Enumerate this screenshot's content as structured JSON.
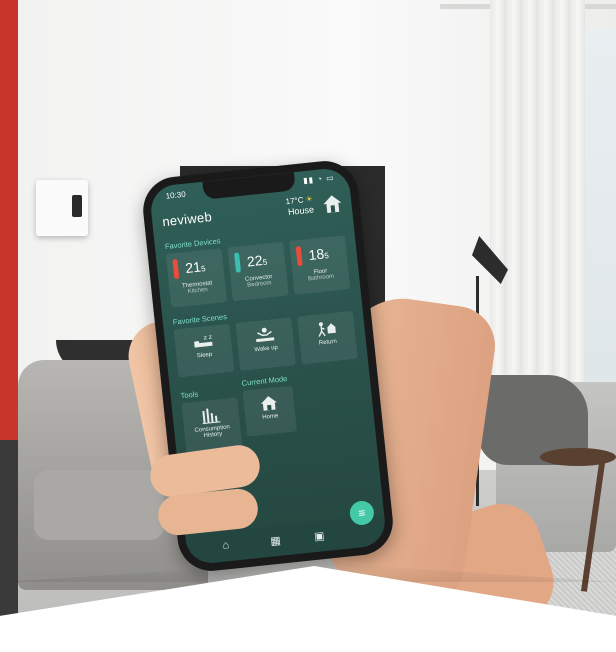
{
  "status_bar": {
    "time": "10:30",
    "indicators": "▮▮ ◔ ▭"
  },
  "header": {
    "logo": "neviweb",
    "outdoor_temp": "17°C",
    "weather_icon": "sun-icon",
    "location": "House"
  },
  "favorite_devices": {
    "title": "Favorite Devices",
    "items": [
      {
        "temp": "21",
        "decimal": "5",
        "name": "Thermostat",
        "room": "Kitchen",
        "color": "#e74c3c"
      },
      {
        "temp": "22",
        "decimal": "5",
        "name": "Convector",
        "room": "Bedroom",
        "color": "#39c0b0"
      },
      {
        "temp": "18",
        "decimal": "5",
        "name": "Floor",
        "room": "Bathroom",
        "color": "#e74c3c"
      }
    ]
  },
  "favorite_scenes": {
    "title": "Favorite Scenes",
    "items": [
      {
        "label": "Sleep",
        "icon": "sleep-icon"
      },
      {
        "label": "Wake up",
        "icon": "wake-up-icon"
      },
      {
        "label": "Return",
        "icon": "return-home-icon"
      }
    ]
  },
  "tools": {
    "title": "Tools",
    "item": {
      "label1": "Consumption",
      "label2": "History",
      "icon": "bar-chart-icon"
    }
  },
  "current_mode": {
    "title": "Current Mode",
    "item": {
      "label": "Home",
      "icon": "home-icon"
    }
  },
  "tab_bar": [
    "home-tab-icon",
    "grid-tab-icon",
    "scenes-tab-icon"
  ],
  "menu_button": "menu-icon",
  "colors": {
    "screen_bg": "#2a514b",
    "accent": "#43c9a6",
    "section_title": "#7fe0c9"
  }
}
